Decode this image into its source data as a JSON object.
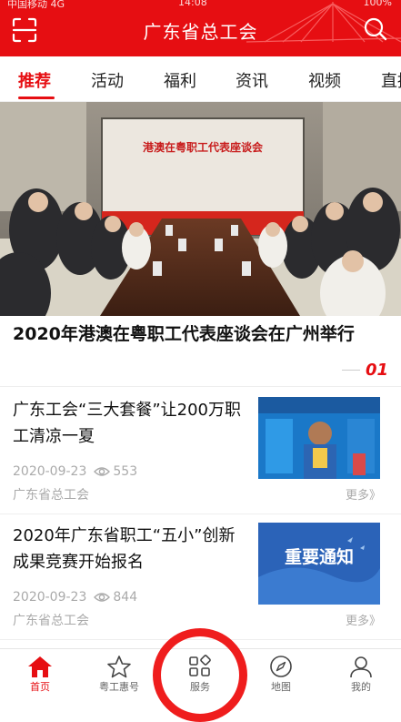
{
  "header": {
    "title": "广东省总工会",
    "status_left": "中国移动 4G",
    "status_center": "14:08",
    "status_right": "100%"
  },
  "tabs": [
    {
      "label": "推荐",
      "active": true
    },
    {
      "label": "活动"
    },
    {
      "label": "福利"
    },
    {
      "label": "资讯"
    },
    {
      "label": "视频"
    },
    {
      "label": "直播"
    }
  ],
  "hero": {
    "banner_text": "港澳在粤职工代表座谈会",
    "caption": "2020年港澳在粤职工代表座谈会在广州举行",
    "index": "01"
  },
  "news": [
    {
      "title": "广东工会“三大套餐”让200万职工清凉一夏",
      "date": "2020-09-23",
      "views": "553",
      "source": "广东省总工会",
      "more": "更多》"
    },
    {
      "title": "2020年广东省职工“五小”创新成果竞赛开始报名",
      "date": "2020-09-23",
      "views": "844",
      "source": "广东省总工会",
      "more": "更多》",
      "thumb_text": "重要通知"
    }
  ],
  "bottom_nav": [
    {
      "label": "首页",
      "icon": "home-icon",
      "active": true
    },
    {
      "label": "粤工惠号",
      "icon": "star-icon"
    },
    {
      "label": "服务",
      "icon": "grid-icon"
    },
    {
      "label": "地图",
      "icon": "compass-icon"
    },
    {
      "label": "我的",
      "icon": "user-icon"
    }
  ],
  "colors": {
    "brand_red": "#e60e12",
    "annotation_ring": "#ef1d1d"
  }
}
